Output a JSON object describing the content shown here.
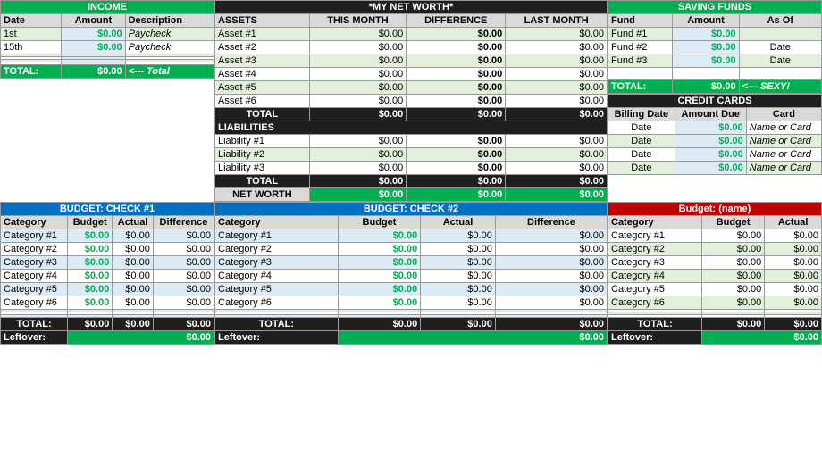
{
  "income": {
    "title": "INCOME",
    "headers": [
      "Date",
      "Amount",
      "Description"
    ],
    "rows": [
      {
        "date": "1st",
        "amount": "$0.00",
        "desc": "Paycheck"
      },
      {
        "date": "15th",
        "amount": "$0.00",
        "desc": "Paycheck"
      },
      {
        "date": "",
        "amount": "",
        "desc": ""
      },
      {
        "date": "",
        "amount": "",
        "desc": ""
      },
      {
        "date": "",
        "amount": "",
        "desc": ""
      },
      {
        "date": "",
        "amount": "",
        "desc": ""
      }
    ],
    "total_label": "TOTAL:",
    "total_amount": "$0.00",
    "total_desc": "<--- Total"
  },
  "net_worth": {
    "title": "*MY NET WORTH*",
    "col_assets": "ASSETS",
    "col_this_month": "THIS MONTH",
    "col_difference": "DIFFERENCE",
    "col_last_month": "LAST MONTH",
    "assets": [
      {
        "name": "Asset #1",
        "this_month": "$0.00",
        "diff": "$0.00",
        "last_month": "$0.00"
      },
      {
        "name": "Asset #2",
        "this_month": "$0.00",
        "diff": "$0.00",
        "last_month": "$0.00"
      },
      {
        "name": "Asset #3",
        "this_month": "$0.00",
        "diff": "$0.00",
        "last_month": "$0.00"
      },
      {
        "name": "Asset #4",
        "this_month": "$0.00",
        "diff": "$0.00",
        "last_month": "$0.00"
      },
      {
        "name": "Asset #5",
        "this_month": "$0.00",
        "diff": "$0.00",
        "last_month": "$0.00"
      },
      {
        "name": "Asset #6",
        "this_month": "$0.00",
        "diff": "$0.00",
        "last_month": "$0.00"
      }
    ],
    "total_assets": {
      "label": "TOTAL",
      "this_month": "$0.00",
      "diff": "$0.00",
      "last_month": "$0.00"
    },
    "liabilities_label": "LIABILITIES",
    "liabilities": [
      {
        "name": "Liability #1",
        "this_month": "$0.00",
        "diff": "$0.00",
        "last_month": "$0.00"
      },
      {
        "name": "Liability #2",
        "this_month": "$0.00",
        "diff": "$0.00",
        "last_month": "$0.00"
      },
      {
        "name": "Liability #3",
        "this_month": "$0.00",
        "diff": "$0.00",
        "last_month": "$0.00"
      }
    ],
    "total_liabilities": {
      "label": "TOTAL",
      "this_month": "$0.00",
      "diff": "$0.00",
      "last_month": "$0.00"
    },
    "net_worth_row": {
      "label": "NET WORTH",
      "this_month": "$0.00",
      "diff": "$0.00",
      "last_month": "$0.00"
    }
  },
  "saving_funds": {
    "title": "SAVING FUNDS",
    "headers": [
      "Fund",
      "Amount",
      "As Of"
    ],
    "rows": [
      {
        "fund": "Fund #1",
        "amount": "$0.00",
        "as_of": ""
      },
      {
        "fund": "Fund #2",
        "amount": "$0.00",
        "as_of": "Date"
      },
      {
        "fund": "Fund #3",
        "amount": "$0.00",
        "as_of": "Date"
      }
    ],
    "total_label": "TOTAL:",
    "total_amount": "$0.00",
    "total_sexy": "<--- SEXY!"
  },
  "credit_cards": {
    "title": "CREDIT CARDS",
    "headers": [
      "Billing Date",
      "Amount Due",
      "Card"
    ],
    "rows": [
      {
        "date": "Date",
        "amount": "$0.00",
        "card": "Name or Card"
      },
      {
        "date": "Date",
        "amount": "$0.00",
        "card": "Name or Card"
      },
      {
        "date": "Date",
        "amount": "$0.00",
        "card": "Name or Card"
      },
      {
        "date": "Date",
        "amount": "$0.00",
        "card": "Name or Card"
      }
    ]
  },
  "budget_check1": {
    "title": "BUDGET: CHECK #1",
    "headers": [
      "Category",
      "Budget",
      "Actual",
      "Difference"
    ],
    "rows": [
      {
        "cat": "Category #1",
        "budget": "$0.00",
        "actual": "$0.00",
        "diff": "$0.00"
      },
      {
        "cat": "Category #2",
        "budget": "$0.00",
        "actual": "$0.00",
        "diff": "$0.00"
      },
      {
        "cat": "Category #3",
        "budget": "$0.00",
        "actual": "$0.00",
        "diff": "$0.00"
      },
      {
        "cat": "Category #4",
        "budget": "$0.00",
        "actual": "$0.00",
        "diff": "$0.00"
      },
      {
        "cat": "Category #5",
        "budget": "$0.00",
        "actual": "$0.00",
        "diff": "$0.00"
      },
      {
        "cat": "Category #6",
        "budget": "$0.00",
        "actual": "$0.00",
        "diff": "$0.00"
      },
      {
        "cat": "",
        "budget": "",
        "actual": "",
        "diff": ""
      },
      {
        "cat": "",
        "budget": "",
        "actual": "",
        "diff": ""
      },
      {
        "cat": "",
        "budget": "",
        "actual": "",
        "diff": ""
      }
    ],
    "total_label": "TOTAL:",
    "total_budget": "$0.00",
    "total_actual": "$0.00",
    "total_diff": "$0.00",
    "leftover_label": "Leftover:",
    "leftover_amount": "$0.00"
  },
  "budget_check2": {
    "title": "BUDGET: CHECK #2",
    "headers": [
      "Category",
      "Budget",
      "Actual",
      "Difference"
    ],
    "rows": [
      {
        "cat": "Category #1",
        "budget": "$0.00",
        "actual": "$0.00",
        "diff": "$0.00"
      },
      {
        "cat": "Category #2",
        "budget": "$0.00",
        "actual": "$0.00",
        "diff": "$0.00"
      },
      {
        "cat": "Category #3",
        "budget": "$0.00",
        "actual": "$0.00",
        "diff": "$0.00"
      },
      {
        "cat": "Category #4",
        "budget": "$0.00",
        "actual": "$0.00",
        "diff": "$0.00"
      },
      {
        "cat": "Category #5",
        "budget": "$0.00",
        "actual": "$0.00",
        "diff": "$0.00"
      },
      {
        "cat": "Category #6",
        "budget": "$0.00",
        "actual": "$0.00",
        "diff": "$0.00"
      },
      {
        "cat": "",
        "budget": "",
        "actual": "",
        "diff": ""
      },
      {
        "cat": "",
        "budget": "",
        "actual": "",
        "diff": ""
      },
      {
        "cat": "",
        "budget": "",
        "actual": "",
        "diff": ""
      }
    ],
    "total_label": "TOTAL:",
    "total_budget": "$0.00",
    "total_actual": "$0.00",
    "total_diff": "$0.00",
    "leftover_label": "Leftover:",
    "leftover_amount": "$0.00"
  },
  "budget_name": {
    "title": "Budget: (name)",
    "headers": [
      "Category",
      "Budget",
      "Actual"
    ],
    "rows": [
      {
        "cat": "Category #1",
        "budget": "$0.00",
        "actual": "$0.00"
      },
      {
        "cat": "Category #2",
        "budget": "$0.00",
        "actual": "$0.00"
      },
      {
        "cat": "Category #3",
        "budget": "$0.00",
        "actual": "$0.00"
      },
      {
        "cat": "Category #4",
        "budget": "$0.00",
        "actual": "$0.00"
      },
      {
        "cat": "Category #5",
        "budget": "$0.00",
        "actual": "$0.00"
      },
      {
        "cat": "Category #6",
        "budget": "$0.00",
        "actual": "$0.00"
      },
      {
        "cat": "",
        "budget": "",
        "actual": ""
      },
      {
        "cat": "",
        "budget": "",
        "actual": ""
      },
      {
        "cat": "",
        "budget": "",
        "actual": ""
      }
    ],
    "total_label": "TOTAL:",
    "total_budget": "$0.00",
    "total_actual": "$0.00",
    "leftover_label": "Leftover:",
    "leftover_amount": "$0.00"
  }
}
